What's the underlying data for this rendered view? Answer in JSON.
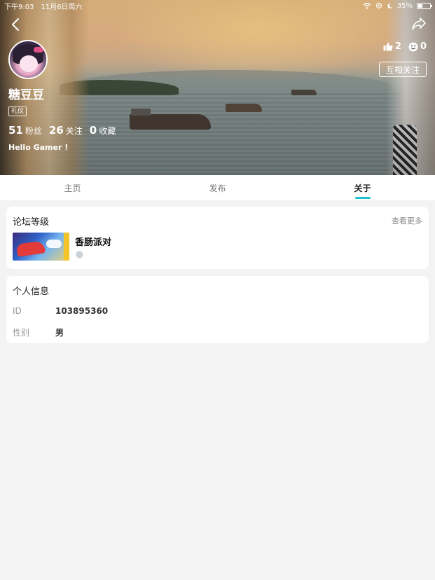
{
  "status_bar": {
    "time": "下午9:03",
    "date": "11月6日周六",
    "battery": "35%",
    "battery_level": 0.35,
    "icons": [
      "wifi-icon",
      "location-icon",
      "moon-icon",
      "battery-icon"
    ]
  },
  "header": {
    "back_icon": "back-chevron-icon",
    "share_icon": "share-icon",
    "likes": "2",
    "likes_icon": "thumbs-up-icon",
    "smiles": "0",
    "smiles_icon": "smile-icon",
    "follow_label": "互相关注",
    "username": "糖豆豆",
    "tag": "礼仪",
    "counts": [
      {
        "num": "51",
        "label": "粉丝"
      },
      {
        "num": "26",
        "label": "关注"
      },
      {
        "num": "0",
        "label": "收藏"
      }
    ],
    "bio": "Hello Gamer !"
  },
  "tabs": [
    {
      "label": "主页",
      "active": false
    },
    {
      "label": "发布",
      "active": false
    },
    {
      "label": "关于",
      "active": true
    }
  ],
  "accent_color": "#1cc4d0",
  "forum_level": {
    "title": "论坛等级",
    "more": "查看更多",
    "game": {
      "name": "香肠派对"
    }
  },
  "personal_info": {
    "title": "个人信息",
    "rows": [
      {
        "key": "ID",
        "value": "103895360"
      },
      {
        "key": "性别",
        "value": "男"
      }
    ]
  }
}
